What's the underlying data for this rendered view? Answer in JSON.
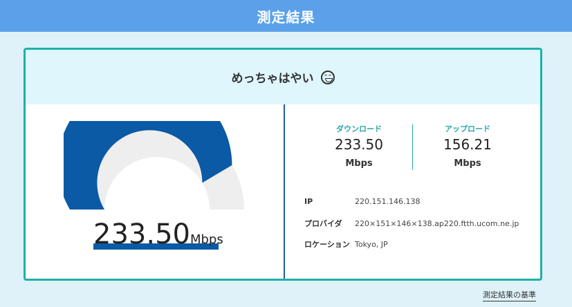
{
  "header": {
    "title": "測定結果"
  },
  "result": {
    "verdict": "めっちゃはやい",
    "emoji": "grinning-squinting-face-icon",
    "gauge_value": 233.5,
    "gauge_fill_fraction": 0.83,
    "big_value": "233.50",
    "big_unit": "Mbps"
  },
  "speeds": {
    "download": {
      "label": "ダウンロード",
      "value": "233.50",
      "unit": "Mbps"
    },
    "upload": {
      "label": "アップロード",
      "value": "156.21",
      "unit": "Mbps"
    }
  },
  "info": {
    "ip": {
      "label": "IP",
      "value": "220.151.146.138"
    },
    "provider": {
      "label": "プロバイダ",
      "value": "220×151×146×138.ap220.ftth.ucom.ne.jp"
    },
    "location": {
      "label": "ロケーション",
      "value": "Tokyo, JP"
    }
  },
  "footer": {
    "link": "測定結果の基準"
  },
  "colors": {
    "header": "#5aa1ea",
    "accent": "#1fb0a8",
    "gauge_fill": "#0b5aa5",
    "gauge_track": "#eeeeee",
    "label_teal": "#2aa7a7"
  }
}
